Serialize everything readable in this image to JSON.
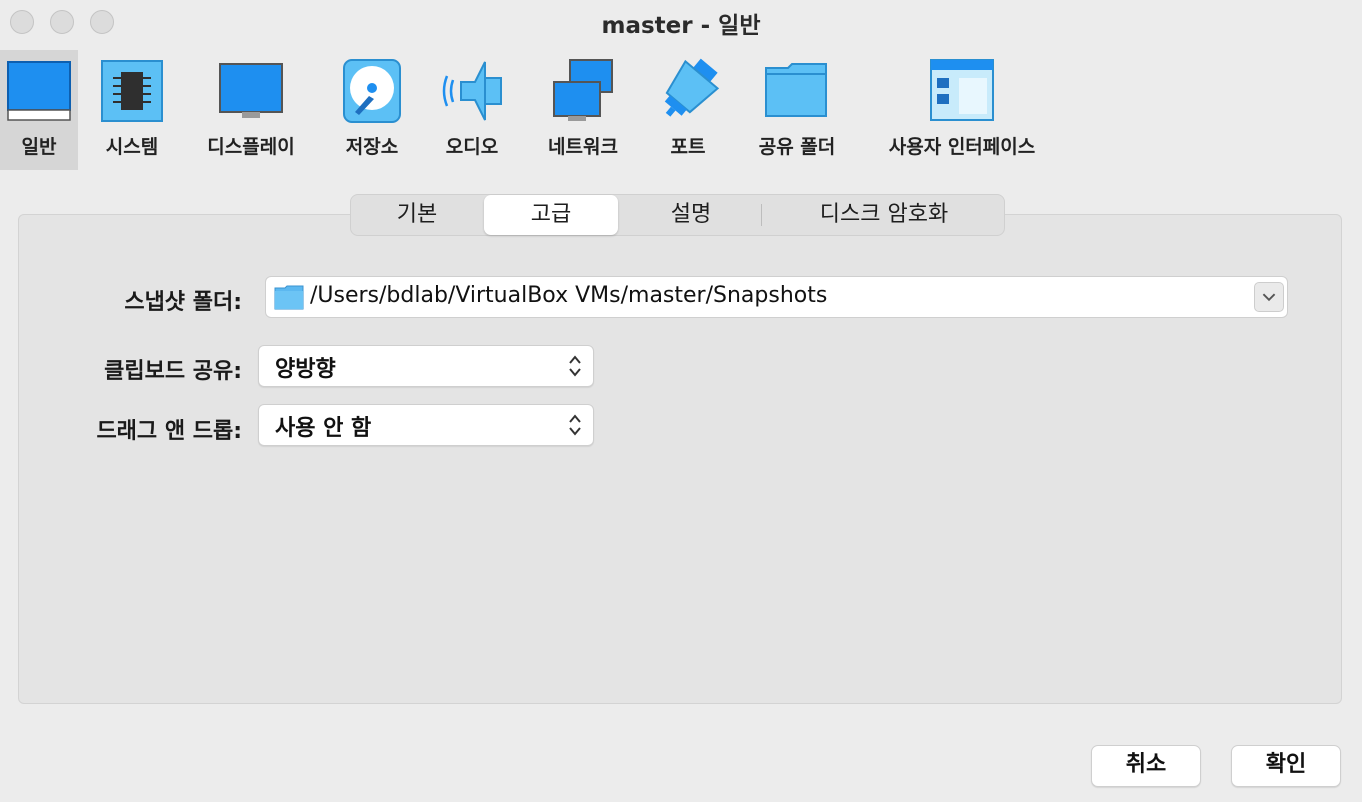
{
  "window": {
    "title": "master - 일반"
  },
  "toolbar": {
    "items": [
      {
        "label": "일반",
        "icon": "general-icon",
        "selected": true
      },
      {
        "label": "시스템",
        "icon": "chip-icon"
      },
      {
        "label": "디스플레이",
        "icon": "monitor-icon"
      },
      {
        "label": "저장소",
        "icon": "disk-icon"
      },
      {
        "label": "오디오",
        "icon": "speaker-icon"
      },
      {
        "label": "네트워크",
        "icon": "network-icon"
      },
      {
        "label": "포트",
        "icon": "serial-port-icon"
      },
      {
        "label": "공유 폴더",
        "icon": "shared-folder-icon"
      },
      {
        "label": "사용자 인터페이스",
        "icon": "user-interface-icon"
      }
    ]
  },
  "tabs": {
    "items": [
      {
        "label": "기본"
      },
      {
        "label": "고급",
        "active": true
      },
      {
        "label": "설명"
      },
      {
        "label": "디스크 암호화"
      }
    ]
  },
  "form": {
    "snapshot_folder": {
      "label": "스냅샷 폴더:",
      "value": "/Users/bdlab/VirtualBox VMs/master/Snapshots"
    },
    "clipboard": {
      "label": "클립보드 공유:",
      "value": "양방향"
    },
    "drag_drop": {
      "label": "드래그 앤 드롭:",
      "value": "사용 안 함"
    }
  },
  "buttons": {
    "cancel": "취소",
    "ok": "확인"
  },
  "colors": {
    "accent_blue": "#1e8ff0",
    "light_blue": "#5cc0f5",
    "window_bg": "#ececec",
    "panel_bg": "#e4e4e4"
  }
}
